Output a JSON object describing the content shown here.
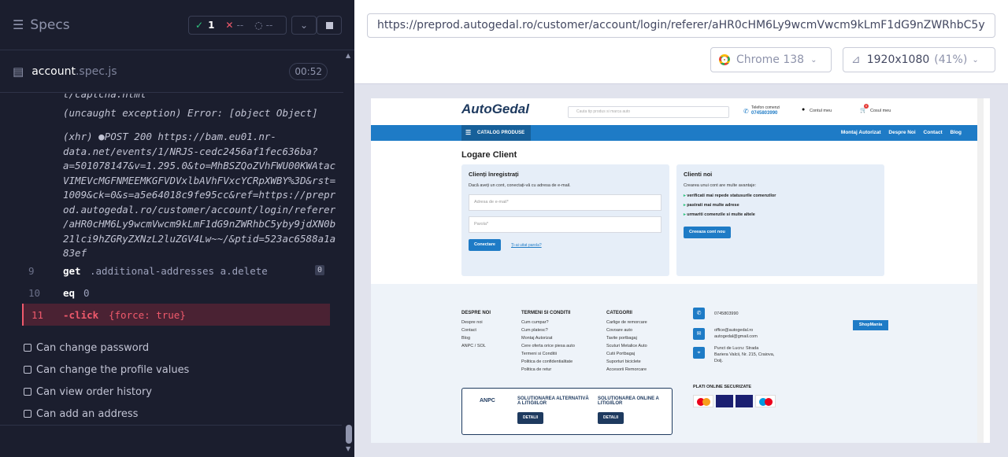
{
  "runner": {
    "specs_title": "Specs",
    "stats": {
      "passed": "1",
      "failed": "--",
      "pending": "--"
    },
    "spec": {
      "name": "account",
      "ext": ".spec.js",
      "duration": "00:52"
    },
    "log_lines": [
      "t/captcha.html",
      "(uncaught exception)  Error: [object Object]",
      "(xhr)  ●POST 200 https://bam.eu01.nr-",
      "data.net/events/1/NRJS-cedc2456af1fec636ba?",
      "a=501078147&v=1.295.0&to=MhBSZQoZVhFWU00KWAtac",
      "VIMEVcMGFNMEEMKGFVDVxlbAVhFVxcYCRpXWBY%3D&rst=",
      "1009&ck=0&s=a5e64018c9fe95cc&ref=https://prepr",
      "od.autogedal.ro/customer/account/login/referer",
      "/aHR0cHM6Ly9wcmVwcm9kLmF1dG9nZWRhbC5yby9jdXN0b",
      "21lci9hZGRyZXNzL2luZGV4Lw~~/&ptid=523ac6588a1a",
      "83ef"
    ],
    "commands": [
      {
        "num": "9",
        "name": "get",
        "arg": ".additional-addresses a.delete",
        "badge": "0"
      },
      {
        "num": "10",
        "name": "eq",
        "arg": "0"
      },
      {
        "num": "11",
        "name": "-click",
        "arg": "{force: true}"
      }
    ],
    "tests": [
      "Can change password",
      "Can change the profile values",
      "Can view order history",
      "Can add an address"
    ]
  },
  "browser": {
    "url": "https://preprod.autogedal.ro/customer/account/login/referer/aHR0cHM6Ly9wcmVwcm9kLmF1dG9nZWRhbC5y",
    "browser_name": "Chrome 138",
    "viewport": "1920x1080",
    "zoom": "(41%)"
  },
  "site": {
    "logo": "AutoGedal",
    "search_placeholder": "Cauta tip produs si marca auto",
    "phone_label": "Telefon comenzi",
    "phone": "0745803990",
    "account": "Contul meu",
    "cart": "Cosul meu",
    "cart_count": "0",
    "catalog": "CATALOG PRODUSE",
    "nav": [
      "Montaj Autorizat",
      "Despre Noi",
      "Contact",
      "Blog"
    ],
    "page_title": "Logare Client",
    "registered": {
      "title": "Clienți înregistrați",
      "desc": "Dacă aveți un cont, conectați-vă cu adresa de e-mail.",
      "email_placeholder": "Adresa de e-mail*",
      "password_placeholder": "Parola*",
      "login_button": "Conectare",
      "forgot": "Ți-ai uitat parola?"
    },
    "new_clients": {
      "title": "Clienti noi",
      "desc": "Crearea unui cont are multe avantaje:",
      "bullets": [
        "verificati mai repede statusurile comenzilor",
        "pastrati mai multe adrese",
        "urmariti comenzile si multe altele"
      ],
      "create_button": "Creeaza cont nou"
    },
    "footer": {
      "col1": {
        "title": "DESPRE NOI",
        "items": [
          "Despre noi",
          "Contact",
          "Blog",
          "ANPC / SOL"
        ]
      },
      "col2": {
        "title": "TERMENI SI CONDITII",
        "items": [
          "Cum cumpar?",
          "Cum platesc?",
          "Montaj Autorizat",
          "Cere oferta orice piesa auto",
          "Termeni si Conditii",
          "Politica de confidentialitate",
          "Politica de retur"
        ]
      },
      "col3": {
        "title": "CATEGORII",
        "items": [
          "Carlige de remorcare",
          "Covoare auto",
          "Tavite portbagaj",
          "Scuturi Metalice Auto",
          "Cutii Portbagaj",
          "Suporturi biciclete",
          "Accesorii Remorcare"
        ]
      },
      "phone": "0745803990",
      "emails": [
        "office@autogedal.ro",
        "autogedal@gmail.com"
      ],
      "address": [
        "Punct de Lucru: Strada",
        "Bariera Valcii, Nr. 215, Craiova,",
        "Dolj."
      ],
      "shopmania": "ShopMania",
      "payments_title": "PLATI ONLINE SECURIZATE",
      "anpc": {
        "name": "ANPC",
        "alt": "SOLUȚIONAREA ALTERNATIVĂ A LITIGIILOR",
        "online": "SOLUȚIONAREA ONLINE A LITIGIILOR",
        "details": "DETALII"
      }
    }
  }
}
